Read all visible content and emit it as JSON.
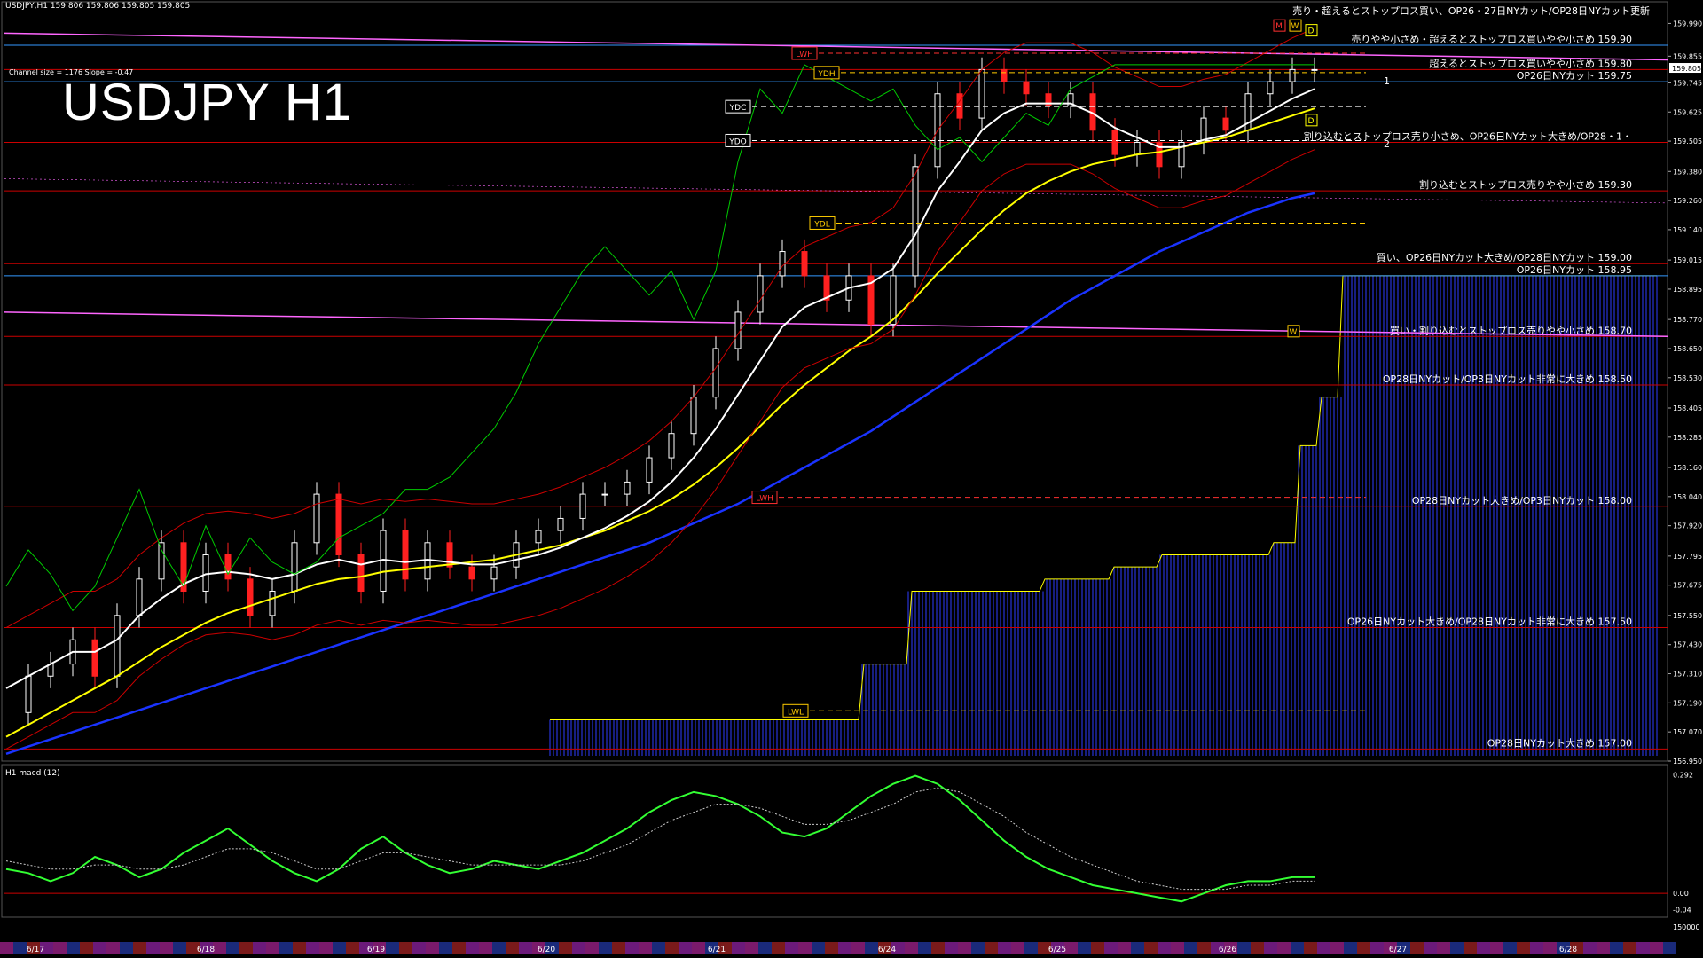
{
  "header": {
    "symbol_line": "USDJPY,H1  159.806 159.806 159.805 159.805",
    "title": "USDJPY H1",
    "channel": "Channel size = 1176 Slope = -0.47",
    "macd_label": "H1  macd (12)",
    "top_banner": "売り・超えるとストップロス買い、OP26・27日NYカット/OP28日NYカット更新"
  },
  "colors": {
    "background": "#000000",
    "up_candle": "#ffffff",
    "down_candle": "#ff2020",
    "ma_fast": "#ffffff",
    "ma_mid": "#ffff00",
    "ma_slow": "#1a33ff",
    "cloud": "#2e3cff",
    "bollinger": "#cc0000",
    "chikou": "#00cc00",
    "level_red": "#cc0000",
    "level_blue": "#3399ff",
    "level_magenta": "#ff66ff",
    "macd_up": "#33ff33",
    "macd_down": "#ff7f9f"
  },
  "chart_data": {
    "type": "line",
    "title": "USDJPY H1",
    "price_ylim": [
      156.95,
      160.05
    ],
    "price_ticks": [
      "159.990",
      "159.855",
      "159.745",
      "159.625",
      "159.505",
      "159.380",
      "159.260",
      "159.140",
      "159.015",
      "158.895",
      "158.770",
      "158.650",
      "158.530",
      "158.405",
      "158.285",
      "158.160",
      "158.040",
      "157.920",
      "157.795",
      "157.675",
      "157.550",
      "157.430",
      "157.310",
      "157.190",
      "157.070",
      "156.950"
    ],
    "price_tag": "159.805",
    "macd_ticks": [
      "0.292",
      "0.00",
      "-0.04"
    ],
    "macd_bottom_label": "150000",
    "dates": [
      "6/17",
      "6/18",
      "6/19",
      "6/20",
      "6/21",
      "6/24",
      "6/25",
      "6/26",
      "6/27",
      "6/28"
    ],
    "annotations": {
      "YDH": "YDH",
      "YDC": "YDC",
      "YDO": "YDO",
      "YDL": "YDL",
      "LWH": "LWH",
      "LWL": "LWL",
      "M": "M",
      "W": "W",
      "D": "D",
      "L1": "1",
      "L2": "2"
    },
    "close_series": [
      157.15,
      157.3,
      157.35,
      157.45,
      157.3,
      157.55,
      157.7,
      157.85,
      157.65,
      157.8,
      157.7,
      157.55,
      157.65,
      157.85,
      158.05,
      157.8,
      157.65,
      157.9,
      157.7,
      157.85,
      157.75,
      157.7,
      157.75,
      157.85,
      157.9,
      157.95,
      158.05,
      158.05,
      158.1,
      158.2,
      158.3,
      158.45,
      158.65,
      158.8,
      158.95,
      159.05,
      158.95,
      158.85,
      158.95,
      158.75,
      158.95,
      159.4,
      159.7,
      159.6,
      159.8,
      159.75,
      159.7,
      159.65,
      159.7,
      159.55,
      159.45,
      159.5,
      159.4,
      159.5,
      159.6,
      159.55,
      159.7,
      159.75,
      159.8,
      159.8
    ],
    "ma_fast": [
      157.25,
      157.3,
      157.35,
      157.4,
      157.4,
      157.45,
      157.55,
      157.62,
      157.68,
      157.72,
      157.73,
      157.72,
      157.7,
      157.72,
      157.76,
      157.78,
      157.76,
      157.78,
      157.77,
      157.78,
      157.77,
      157.76,
      157.76,
      157.78,
      157.8,
      157.83,
      157.87,
      157.91,
      157.96,
      158.02,
      158.1,
      158.2,
      158.32,
      158.46,
      158.6,
      158.74,
      158.82,
      158.86,
      158.9,
      158.92,
      158.98,
      159.12,
      159.3,
      159.42,
      159.55,
      159.62,
      159.66,
      159.66,
      159.66,
      159.62,
      159.56,
      159.52,
      159.48,
      159.48,
      159.51,
      159.53,
      159.58,
      159.63,
      159.68,
      159.72
    ],
    "ma_mid": [
      157.05,
      157.1,
      157.15,
      157.2,
      157.25,
      157.3,
      157.36,
      157.42,
      157.47,
      157.52,
      157.56,
      157.59,
      157.62,
      157.65,
      157.68,
      157.7,
      157.71,
      157.73,
      157.74,
      157.75,
      157.76,
      157.77,
      157.78,
      157.8,
      157.82,
      157.84,
      157.87,
      157.9,
      157.94,
      157.98,
      158.03,
      158.09,
      158.16,
      158.24,
      158.33,
      158.42,
      158.5,
      158.57,
      158.64,
      158.7,
      158.77,
      158.86,
      158.96,
      159.05,
      159.14,
      159.22,
      159.29,
      159.34,
      159.38,
      159.41,
      159.43,
      159.45,
      159.46,
      159.48,
      159.5,
      159.52,
      159.55,
      159.58,
      159.61,
      159.64
    ],
    "ma_slow": [
      156.98,
      157.01,
      157.04,
      157.07,
      157.1,
      157.13,
      157.16,
      157.19,
      157.22,
      157.25,
      157.28,
      157.31,
      157.34,
      157.37,
      157.4,
      157.43,
      157.46,
      157.49,
      157.52,
      157.55,
      157.58,
      157.61,
      157.64,
      157.67,
      157.7,
      157.73,
      157.76,
      157.79,
      157.82,
      157.85,
      157.89,
      157.93,
      157.97,
      158.01,
      158.06,
      158.11,
      158.16,
      158.21,
      158.26,
      158.31,
      158.37,
      158.43,
      158.49,
      158.55,
      158.61,
      158.67,
      158.73,
      158.79,
      158.85,
      158.9,
      158.95,
      159.0,
      159.05,
      159.09,
      159.13,
      159.17,
      159.21,
      159.24,
      159.27,
      159.29
    ],
    "cloud_top": [
      156.95,
      156.95,
      156.95,
      156.95,
      156.95,
      156.95,
      156.95,
      156.95,
      156.95,
      156.95,
      156.95,
      156.95,
      156.95,
      156.95,
      156.95,
      156.95,
      156.95,
      156.95,
      156.95,
      156.95,
      157.12,
      157.12,
      157.12,
      157.12,
      157.12,
      157.12,
      157.12,
      157.12,
      157.12,
      157.12,
      157.12,
      157.12,
      157.12,
      157.12,
      157.12,
      157.12,
      157.12,
      157.12,
      157.35,
      157.35,
      157.65,
      157.65,
      157.65,
      157.65,
      157.65,
      157.65,
      157.7,
      157.7,
      157.7,
      157.75,
      157.75,
      157.8,
      157.8,
      157.8,
      157.8,
      157.8,
      157.85,
      158.25,
      158.45,
      158.95
    ],
    "macd": [
      0.06,
      0.05,
      0.03,
      0.05,
      0.09,
      0.07,
      0.04,
      0.06,
      0.1,
      0.13,
      0.16,
      0.12,
      0.08,
      0.05,
      0.03,
      0.06,
      0.11,
      0.14,
      0.1,
      0.07,
      0.05,
      0.06,
      0.08,
      0.07,
      0.06,
      0.08,
      0.1,
      0.13,
      0.16,
      0.2,
      0.23,
      0.25,
      0.24,
      0.22,
      0.19,
      0.15,
      0.14,
      0.16,
      0.2,
      0.24,
      0.27,
      0.29,
      0.27,
      0.23,
      0.18,
      0.13,
      0.09,
      0.06,
      0.04,
      0.02,
      0.01,
      0.0,
      -0.01,
      -0.02,
      0.0,
      0.02,
      0.03,
      0.03,
      0.04,
      0.04
    ],
    "macd_signal": [
      0.08,
      0.07,
      0.06,
      0.06,
      0.07,
      0.07,
      0.06,
      0.06,
      0.07,
      0.09,
      0.11,
      0.11,
      0.1,
      0.08,
      0.06,
      0.06,
      0.08,
      0.1,
      0.1,
      0.09,
      0.08,
      0.07,
      0.07,
      0.07,
      0.07,
      0.07,
      0.08,
      0.1,
      0.12,
      0.15,
      0.18,
      0.2,
      0.22,
      0.22,
      0.21,
      0.19,
      0.17,
      0.17,
      0.18,
      0.2,
      0.22,
      0.25,
      0.26,
      0.25,
      0.22,
      0.19,
      0.15,
      0.12,
      0.09,
      0.07,
      0.05,
      0.03,
      0.02,
      0.01,
      0.01,
      0.01,
      0.02,
      0.02,
      0.03,
      0.03
    ],
    "levels": [
      {
        "price": 159.9,
        "label": "売りやや小さめ・超えるとストップロス買いやや小さめ 159.90",
        "color": "#3399ff"
      },
      {
        "price": 159.8,
        "label": "超えるとストップロス買いやや小さめ 159.80",
        "color": "#cc0000"
      },
      {
        "price": 159.75,
        "label": "OP26日NYカット 159.75",
        "color": "#3399ff"
      },
      {
        "price": 159.5,
        "label": "割り込むとストップロス売り小さめ、OP26日NYカット大きめ/OP28・1・",
        "color": "#cc0000"
      },
      {
        "price": 159.3,
        "label": "割り込むとストップロス売りやや小さめ 159.30",
        "color": "#cc0000"
      },
      {
        "price": 159.0,
        "label": "買い、OP26日NYカット大きめ/OP28日NYカット 159.00",
        "color": "#cc0000"
      },
      {
        "price": 158.95,
        "label": "OP26日NYカット 158.95",
        "color": "#3399ff"
      },
      {
        "price": 158.7,
        "label": "買い・割り込むとストップロス売りやや小さめ 158.70",
        "color": "#cc0000"
      },
      {
        "price": 158.5,
        "label": "OP28日NYカット/OP3日NYカット非常に大きめ 158.50",
        "color": "#cc0000"
      },
      {
        "price": 158.0,
        "label": "OP28日NYカット大きめ/OP3日NYカット 158.00",
        "color": "#cc0000"
      },
      {
        "price": 157.5,
        "label": "OP26日NYカット大きめ/OP28日NYカット非常に大きめ 157.50",
        "color": "#cc0000"
      },
      {
        "price": 157.0,
        "label": "OP28日NYカット大きめ 157.00",
        "color": "#cc0000"
      }
    ]
  }
}
